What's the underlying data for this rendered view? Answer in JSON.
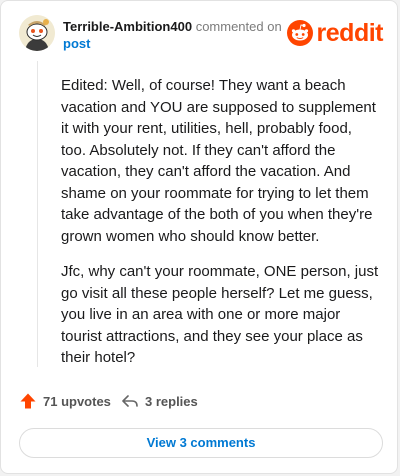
{
  "header": {
    "username": "Terrible-Ambition400",
    "action_text": "commented on",
    "post_link": "post",
    "logo_text": "reddit"
  },
  "comment": {
    "paragraphs": [
      "Edited: Well, of course! They want a beach vacation and YOU are supposed to supplement it with your rent, utilities, hell, probably food, too. Absolutely not. If they can't afford the vacation, they can't afford the vacation. And shame on your roommate for trying to let them take advantage of the both of you when they're grown women who should know better.",
      "Jfc, why can't your roommate, ONE person, just go visit all these people herself? Let me guess, you live in an area with one or more major tourist attractions, and they see your place as their hotel?"
    ]
  },
  "footer": {
    "upvotes": "71 upvotes",
    "replies": "3 replies",
    "view_comments": "View 3 comments"
  },
  "icons": {
    "avatar": "snoo-avatar",
    "logo": "reddit-snoo-icon",
    "upvote": "upvote-arrow-icon",
    "reply": "reply-arrow-icon"
  },
  "colors": {
    "brand": "#ff4500",
    "link": "#0079d3",
    "text": "#1a1a1b"
  }
}
